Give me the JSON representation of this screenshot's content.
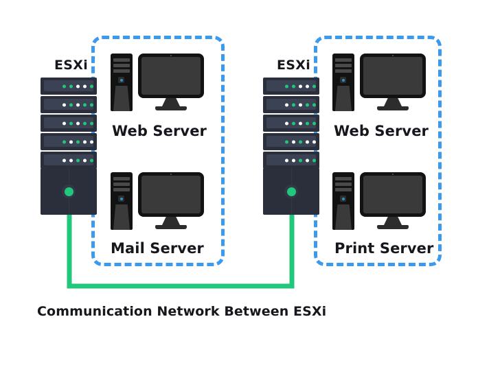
{
  "colors": {
    "group_border": "#3b9aee",
    "network_line": "#21c77a",
    "rack_body": "#2b2f3c",
    "rack_bay": "#3a4254",
    "led_green": "#21c77a",
    "led_white": "#ffffff",
    "text": "#15171c",
    "background": "#ffffff"
  },
  "caption": {
    "network": "Communication Network Between ESXi"
  },
  "hosts": [
    {
      "id": "esxi-left",
      "label": "ESXi",
      "rack": {
        "units": [
          {
            "leds": [
              "g",
              "g",
              "w",
              "w",
              "g"
            ]
          },
          {
            "leds": [
              "w",
              "g",
              "w",
              "g",
              "g"
            ]
          },
          {
            "leds": [
              "w",
              "g",
              "w",
              "g",
              "g"
            ]
          },
          {
            "leds": [
              "g",
              "w",
              "g",
              "w",
              "w"
            ]
          },
          {
            "leds": [
              "w",
              "w",
              "g",
              "w",
              "g"
            ]
          }
        ],
        "power_on": true
      },
      "vms": [
        {
          "id": "vm-web-left",
          "label": "Web Server",
          "icon": "desktop-computer-icon"
        },
        {
          "id": "vm-mail-left",
          "label": "Mail Server",
          "icon": "desktop-computer-icon"
        }
      ]
    },
    {
      "id": "esxi-right",
      "label": "ESXi",
      "rack": {
        "units": [
          {
            "leds": [
              "g",
              "g",
              "w",
              "w",
              "g"
            ]
          },
          {
            "leds": [
              "w",
              "g",
              "w",
              "g",
              "g"
            ]
          },
          {
            "leds": [
              "w",
              "g",
              "w",
              "g",
              "g"
            ]
          },
          {
            "leds": [
              "g",
              "w",
              "g",
              "w",
              "w"
            ]
          },
          {
            "leds": [
              "w",
              "w",
              "g",
              "w",
              "g"
            ]
          }
        ],
        "power_on": true
      },
      "vms": [
        {
          "id": "vm-web-right",
          "label": "Web Server",
          "icon": "desktop-computer-icon"
        },
        {
          "id": "vm-print-right",
          "label": "Print Server",
          "icon": "desktop-computer-icon"
        }
      ]
    }
  ]
}
